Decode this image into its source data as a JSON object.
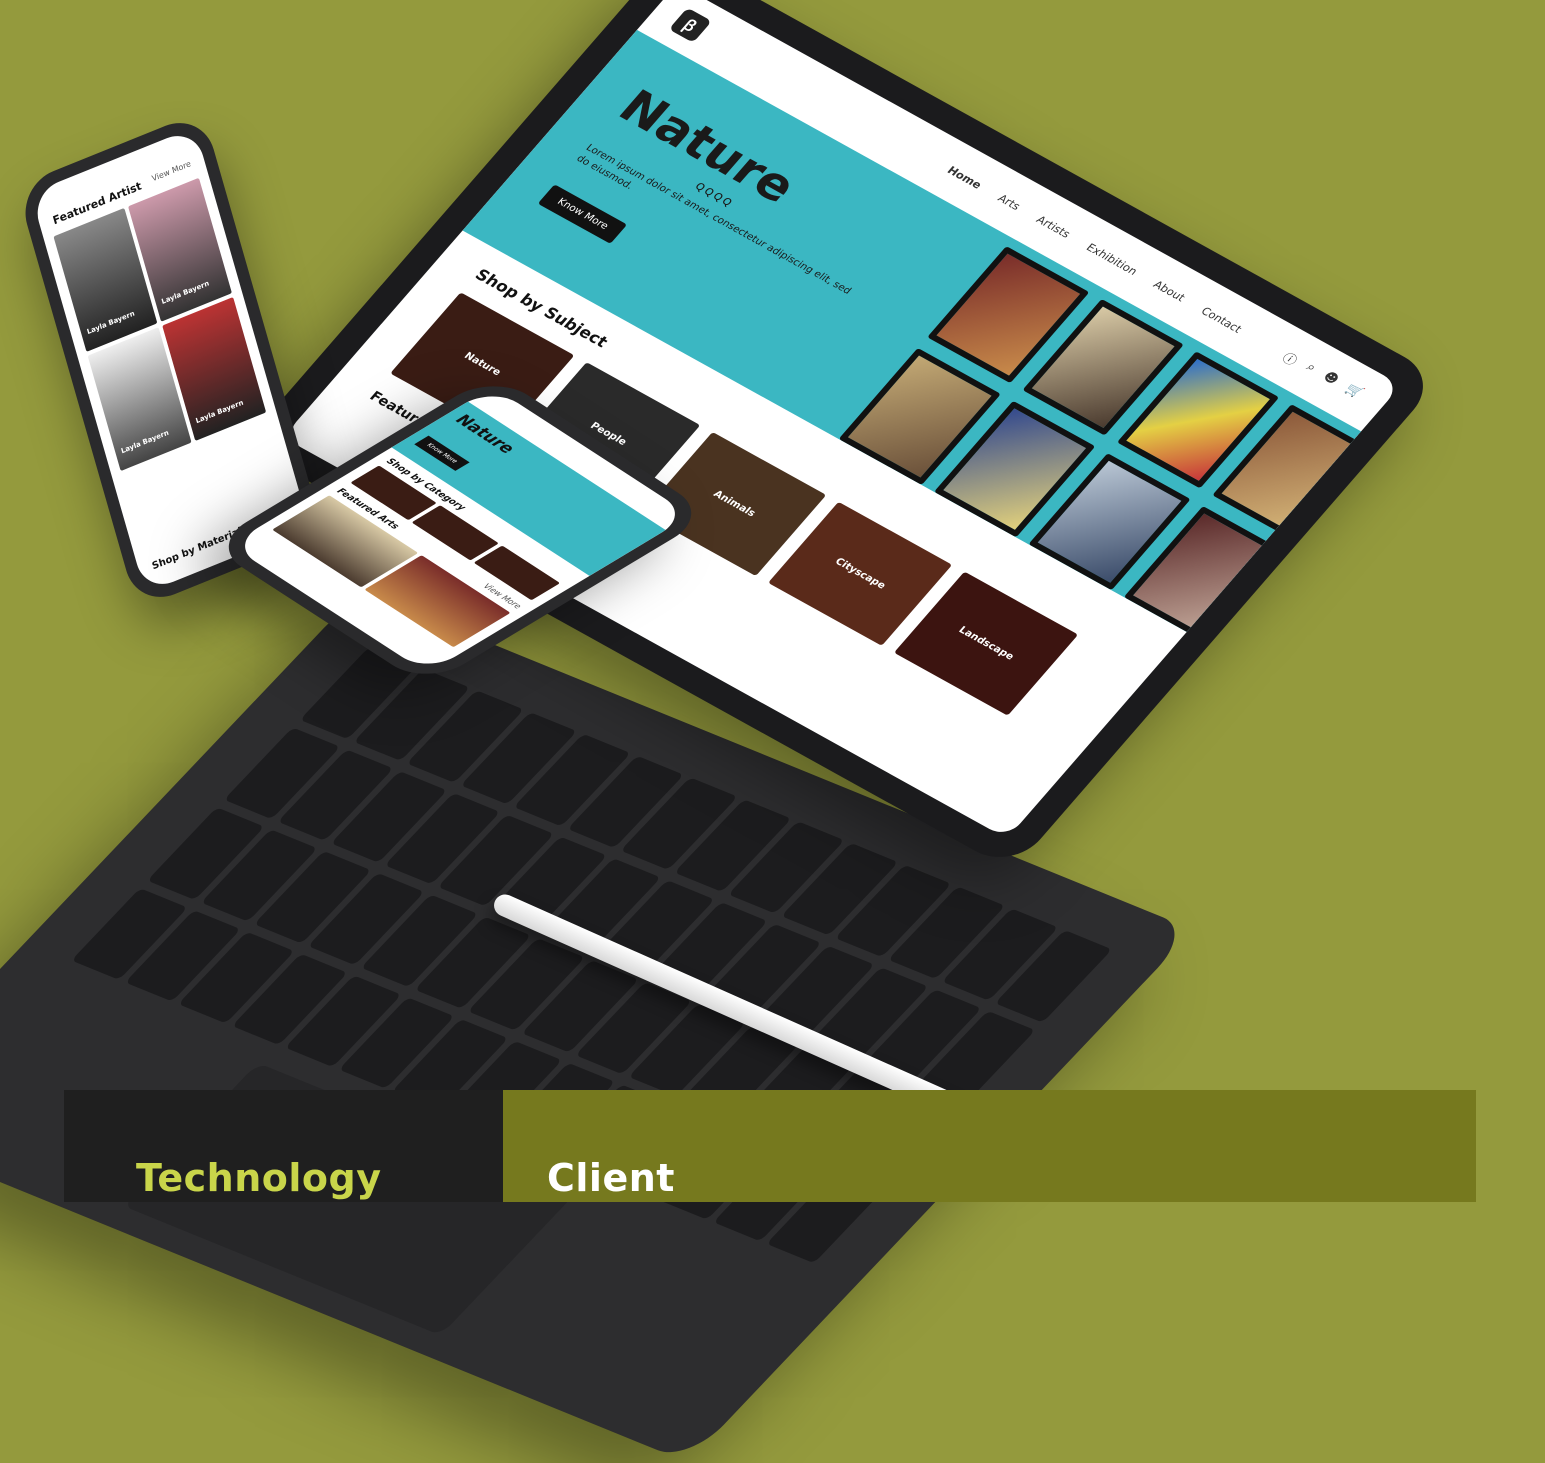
{
  "tablet": {
    "nav": [
      "Home",
      "Arts",
      "Artists",
      "Exhibition",
      "About",
      "Contact"
    ],
    "hero": {
      "title": "Nature",
      "subtitle": "ꞯꞯꞯꞯ",
      "description": "Lorem ipsum dolor sit amet, consectetur adipiscing elit, sed do eiusmod.",
      "button": "Know More"
    },
    "shop_by_subject": "Shop by Subject",
    "subjects": [
      "Nature",
      "People",
      "Animals",
      "Cityscape",
      "Landscape"
    ],
    "featured": "Featured Arts"
  },
  "phone1": {
    "heading": "Featured Artist",
    "view_more": "View More",
    "artists": [
      "Layla Bayern",
      "Layla Bayern",
      "Layla Bayern",
      "Layla Bayern"
    ],
    "footer": "Shop by Material Used"
  },
  "phone2": {
    "hero_title": "Nature",
    "hero_button": "Know More",
    "shop_by_category": "Shop by Category",
    "featured": "Featured Arts",
    "view_more": "View More"
  },
  "info": {
    "technology_label": "Technology",
    "client_label": "Client"
  },
  "colors": {
    "background": "#949a3d",
    "hero_teal": "#3bb7c2",
    "tech_label": "#c9d54a",
    "olive_panel": "#76791e",
    "dark_panel": "#1f1f1f"
  }
}
